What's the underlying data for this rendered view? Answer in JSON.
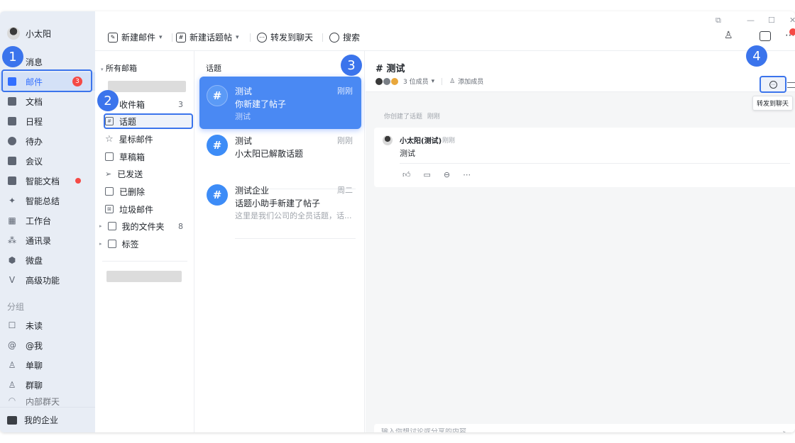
{
  "user": {
    "name": "小太阳"
  },
  "nav": {
    "items": [
      {
        "label": "消息",
        "icon": "message-icon"
      },
      {
        "label": "邮件",
        "icon": "mail-icon",
        "badge": "3"
      },
      {
        "label": "文档",
        "icon": "doc-icon"
      },
      {
        "label": "日程",
        "icon": "calendar-icon"
      },
      {
        "label": "待办",
        "icon": "todo-icon"
      },
      {
        "label": "会议",
        "icon": "meeting-icon"
      },
      {
        "label": "智能文档",
        "icon": "smart-doc-icon",
        "dot": true
      },
      {
        "label": "智能总结",
        "icon": "sparkle-icon"
      },
      {
        "label": "工作台",
        "icon": "workbench-icon"
      },
      {
        "label": "通讯录",
        "icon": "contacts-icon"
      },
      {
        "label": "微盘",
        "icon": "drive-icon"
      },
      {
        "label": "高级功能",
        "icon": "advanced-icon"
      }
    ],
    "group_title": "分组",
    "group_items": [
      {
        "label": "未读",
        "icon": "unread-icon"
      },
      {
        "label": "@我",
        "icon": "at-icon"
      },
      {
        "label": "单聊",
        "icon": "single-chat-icon"
      },
      {
        "label": "群聊",
        "icon": "group-chat-icon"
      },
      {
        "label": "内部群天",
        "icon": "internal-icon"
      }
    ],
    "bottom_label": "我的企业"
  },
  "toolbar": {
    "new_mail": "新建邮件",
    "new_topic": "新建话题帖",
    "forward_chat": "转发到聊天",
    "search": "搜索"
  },
  "folders": {
    "header": "所有邮箱",
    "items": [
      {
        "label": "收件箱",
        "count": "3",
        "icon": "inbox-icon"
      },
      {
        "label": "话题",
        "icon": "hashtag-icon",
        "active": true
      },
      {
        "label": "星标邮件",
        "icon": "star-icon"
      },
      {
        "label": "草稿箱",
        "icon": "draft-icon"
      },
      {
        "label": "已发送",
        "icon": "sent-icon"
      },
      {
        "label": "已删除",
        "icon": "trash-icon"
      },
      {
        "label": "垃圾邮件",
        "icon": "spam-icon"
      },
      {
        "label": "我的文件夹",
        "count": "8",
        "icon": "folder-icon"
      },
      {
        "label": "标签",
        "icon": "tag-icon"
      }
    ]
  },
  "topics": {
    "header": "话题",
    "cards": [
      {
        "title": "测试",
        "time": "刚刚",
        "line2": "你新建了帖子",
        "line3": "测试",
        "active": true
      },
      {
        "title": "测试",
        "time": "刚刚",
        "line2": "小太阳已解散话题",
        "line3": ""
      },
      {
        "title": "测试企业",
        "time": "周二",
        "line2": "话题小助手新建了帖子",
        "line3": "这里是我们公司的全员话题，话..."
      }
    ]
  },
  "detail": {
    "title": "# 测试",
    "members": "3 位成员",
    "add_member": "添加成员",
    "tooltip": "转发到聊天",
    "system_msg": "你创建了话题",
    "system_time": "刚刚",
    "post": {
      "author": "小太阳(测试)",
      "time": "刚刚",
      "body": "测试"
    },
    "input_placeholder": "输入你想讨论或分享的内容..."
  },
  "steps": [
    "1",
    "2",
    "3",
    "4"
  ],
  "colors": {
    "accent": "#3b74ec",
    "badge": "#f54a45",
    "nav_bg": "#e8edf5"
  }
}
